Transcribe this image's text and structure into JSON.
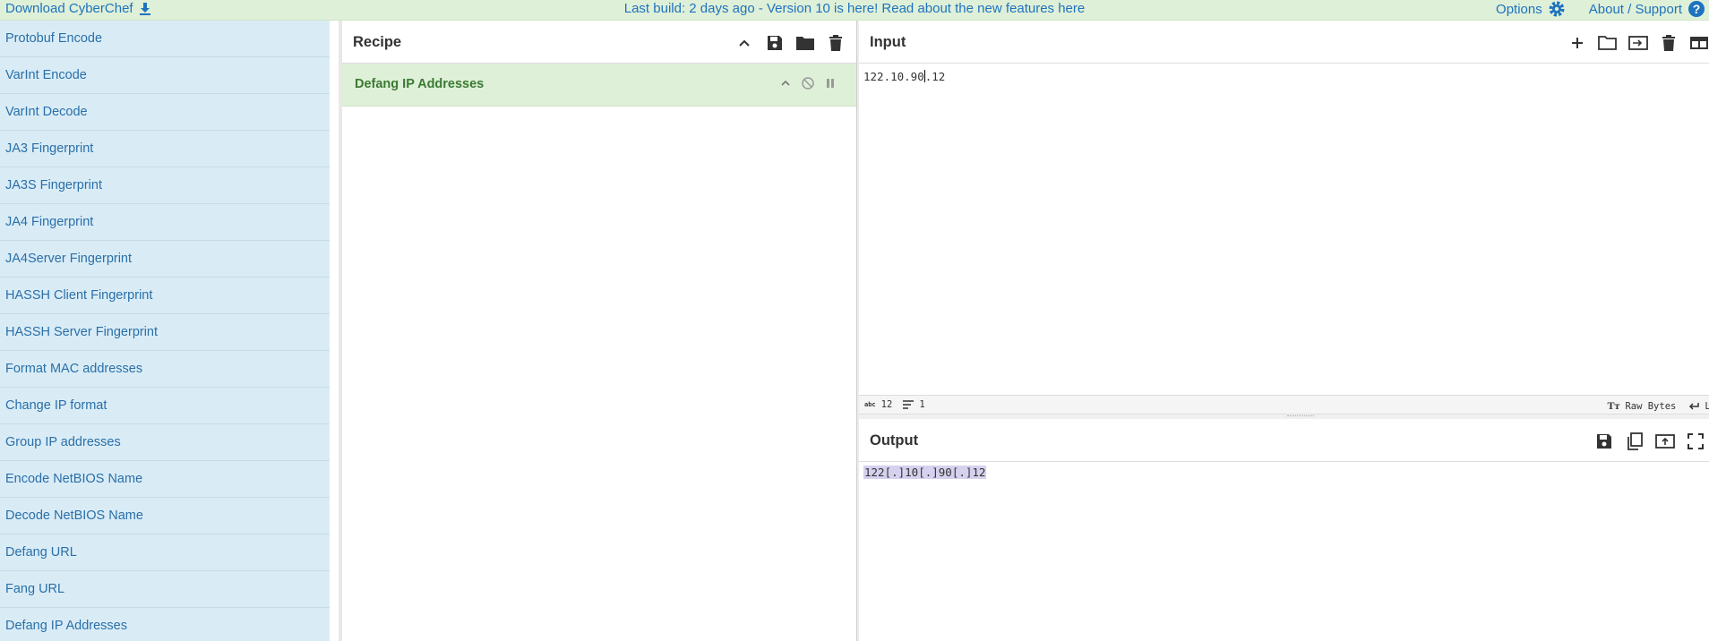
{
  "banner": {
    "download_label": "Download CyberChef",
    "announcement": "Last build: 2 days ago - Version 10 is here! Read about the new features ",
    "announcement_link": "here",
    "options_label": "Options",
    "about_label": "About / Support"
  },
  "operations": [
    "Protobuf Encode",
    "VarInt Encode",
    "VarInt Decode",
    "JA3 Fingerprint",
    "JA3S Fingerprint",
    "JA4 Fingerprint",
    "JA4Server Fingerprint",
    "HASSH Client Fingerprint",
    "HASSH Server Fingerprint",
    "Format MAC addresses",
    "Change IP format",
    "Group IP addresses",
    "Encode NetBIOS Name",
    "Decode NetBIOS Name",
    "Defang URL",
    "Fang URL",
    "Defang IP Addresses"
  ],
  "recipe": {
    "title": "Recipe",
    "operation_name": "Defang IP Addresses"
  },
  "input": {
    "title": "Input",
    "text_before_caret": "122.10.90",
    "text_after_caret": ".12",
    "status": {
      "length_label": "abc",
      "length": "12",
      "lines": "1",
      "encoding": "Raw Bytes",
      "eol": "LF"
    }
  },
  "output": {
    "title": "Output",
    "text": "122[.]10[.]90[.]12"
  },
  "colors": {
    "banner_bg": "#dff0d8",
    "ops_bg": "#d9ecf6",
    "op_block_bg": "#dff0d8",
    "link": "#1e73be",
    "selection": "#d6d1ee"
  }
}
